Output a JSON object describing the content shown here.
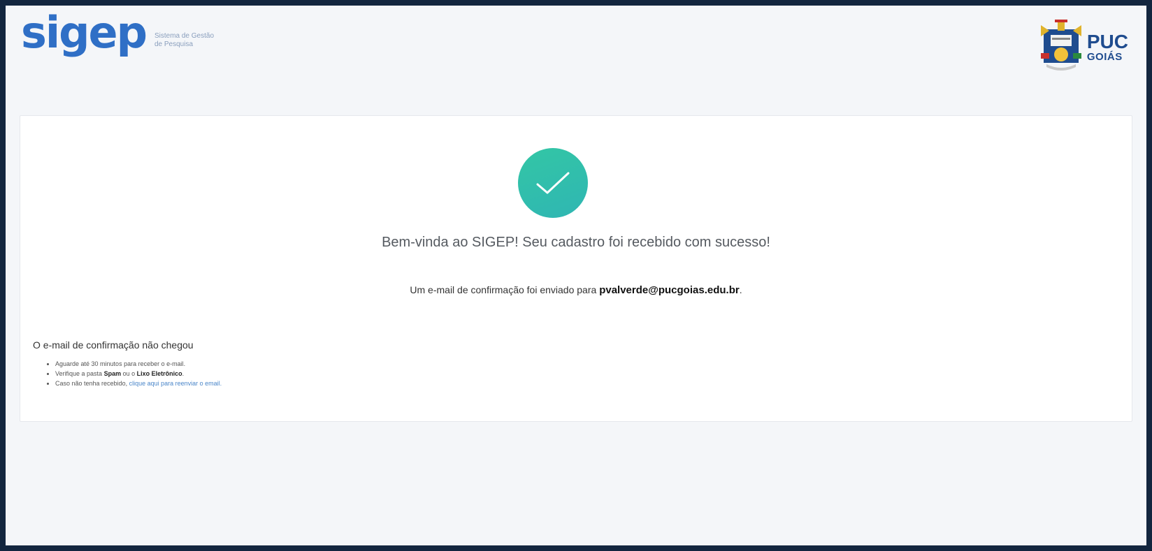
{
  "header": {
    "brand": "sigep",
    "tagline_line1": "Sistema de Gestão",
    "tagline_line2": "de Pesquisa",
    "university_line1": "PUC",
    "university_line2": "GOIÁS"
  },
  "success": {
    "icon": "check-icon",
    "welcome": "Bem-vinda ao SIGEP! Seu cadastro foi recebido com sucesso!",
    "sent_prefix": "Um e-mail de confirmação foi enviado para ",
    "email": "pvalverde@pucgoias.edu.br",
    "sent_suffix": "."
  },
  "help": {
    "title": "O e-mail de confirmação não chegou",
    "item1": "Aguarde até 30 minutos para receber o e-mail.",
    "item2_prefix": "Verifique a pasta ",
    "item2_bold1": "Spam",
    "item2_mid": " ou o ",
    "item2_bold2": "Lixo Eletrônico",
    "item2_suffix": ".",
    "item3_prefix": "Caso não tenha recebido, ",
    "item3_link": "clique aqui para reenviar o email."
  },
  "colors": {
    "brand": "#2f6fc6",
    "success": "#33c6a5",
    "link": "#4a86c9",
    "frame": "#13263f"
  }
}
